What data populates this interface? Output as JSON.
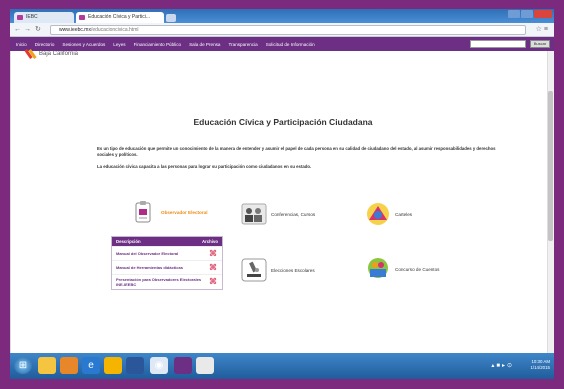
{
  "browser": {
    "tabs": [
      {
        "label": "IEBC"
      },
      {
        "label": "Educación Cívica y Partici..."
      }
    ],
    "url_prefix": "www.ieebc.mx",
    "url_path": "/educacioncivica.html"
  },
  "site_nav": {
    "items": [
      "Inicio",
      "Directorio",
      "Sesiones y Acuerdos",
      "Leyes",
      "Financiamiento Público",
      "Sala de Prensa",
      "Transparencia",
      "Solicitud de Información"
    ],
    "search_button": "Buscar"
  },
  "logo": {
    "text": "Baja California"
  },
  "page": {
    "title": "Educación Cívica y Participación Ciudadana",
    "paragraph1": "Es un tipo de educación que permite un conocimiento de la manera de entender y asumir el papel de cada persona en su calidad de ciudadano del estado, al asumir responsabilidades y derechos sociales y políticos.",
    "paragraph2": "La educación cívica capacita a las personas para lograr su participación como ciudadanos en su estado."
  },
  "cards": {
    "observador": "Observador Electoral",
    "conferencias": "Conferencias, Cursos",
    "carteles": "Carteles",
    "elecciones": "Elecciones Escolares",
    "concurso": "Concurso de Cuentos"
  },
  "documents": {
    "header_desc": "Descripción",
    "header_files": "Archivo",
    "rows": [
      {
        "desc": "Manual del Observador Electoral"
      },
      {
        "desc": "Manual de Herramientas didácticas"
      },
      {
        "desc": "Presentación para Observadores Electorales INE-IEEBC"
      }
    ]
  },
  "taskbar": {
    "time": "10:30 AM",
    "date": "1/14/2015"
  },
  "colors": {
    "purple": "#6c2f83",
    "orange": "#f08a14",
    "background_border": "#7b2a7d"
  }
}
